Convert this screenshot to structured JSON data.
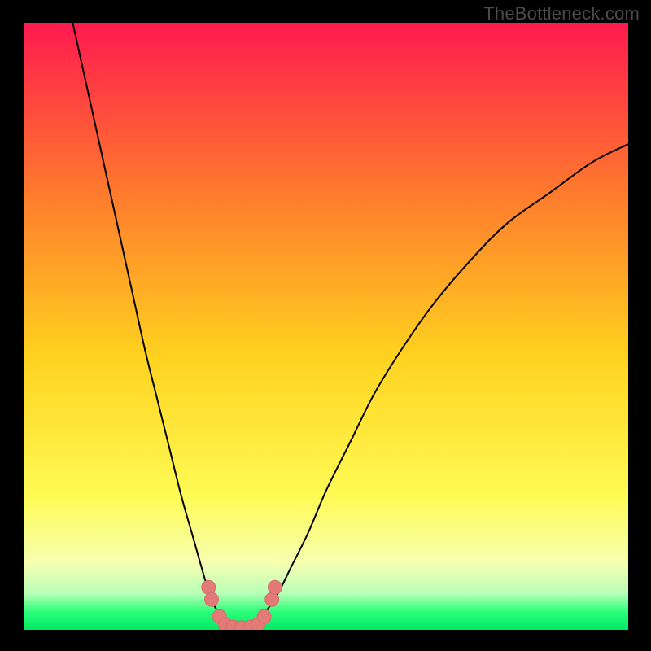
{
  "watermark": "TheBottleneck.com",
  "colors": {
    "frame": "#000000",
    "gradient_top": "#ff1a4f",
    "gradient_mid_upper": "#ff7a2d",
    "gradient_mid": "#ffd21f",
    "gradient_mid_lower": "#fffb55",
    "gradient_lower": "#f6ffb0",
    "gradient_green_pale": "#b8ffb8",
    "gradient_green": "#2dff7a",
    "gradient_bottom": "#00e865",
    "curve": "#000000",
    "marker_fill": "#e37a77",
    "marker_stroke": "#d86a66"
  },
  "chart_data": {
    "type": "line",
    "title": "",
    "xlabel": "",
    "ylabel": "",
    "xlim": [
      0,
      100
    ],
    "ylim": [
      0,
      100
    ],
    "series": [
      {
        "name": "left-branch",
        "x": [
          8,
          10,
          12,
          14,
          16,
          18,
          20,
          22,
          24,
          26,
          28,
          30,
          31,
          32,
          33,
          34
        ],
        "y": [
          100,
          91,
          82,
          73,
          64,
          55,
          46,
          38,
          30,
          22,
          15,
          8,
          5,
          3,
          1.5,
          0.7
        ]
      },
      {
        "name": "right-branch",
        "x": [
          38,
          39,
          40,
          42,
          44,
          47,
          50,
          54,
          58,
          63,
          68,
          74,
          80,
          87,
          94,
          100
        ],
        "y": [
          0.7,
          1.5,
          3,
          6,
          10,
          16,
          23,
          31,
          39,
          47,
          54,
          61,
          67,
          72,
          77,
          80
        ]
      },
      {
        "name": "valley-floor",
        "x": [
          34,
          35,
          36,
          37,
          38
        ],
        "y": [
          0.7,
          0.4,
          0.3,
          0.4,
          0.7
        ]
      }
    ],
    "markers": {
      "name": "valley-markers",
      "points": [
        {
          "x": 30.5,
          "y": 7
        },
        {
          "x": 31.0,
          "y": 5
        },
        {
          "x": 32.3,
          "y": 2.2
        },
        {
          "x": 33.3,
          "y": 0.9
        },
        {
          "x": 34.6,
          "y": 0.45
        },
        {
          "x": 36.0,
          "y": 0.35
        },
        {
          "x": 37.4,
          "y": 0.45
        },
        {
          "x": 38.7,
          "y": 0.9
        },
        {
          "x": 39.7,
          "y": 2.2
        },
        {
          "x": 41.0,
          "y": 5
        },
        {
          "x": 41.5,
          "y": 7
        }
      ],
      "radius": 1.15
    }
  }
}
